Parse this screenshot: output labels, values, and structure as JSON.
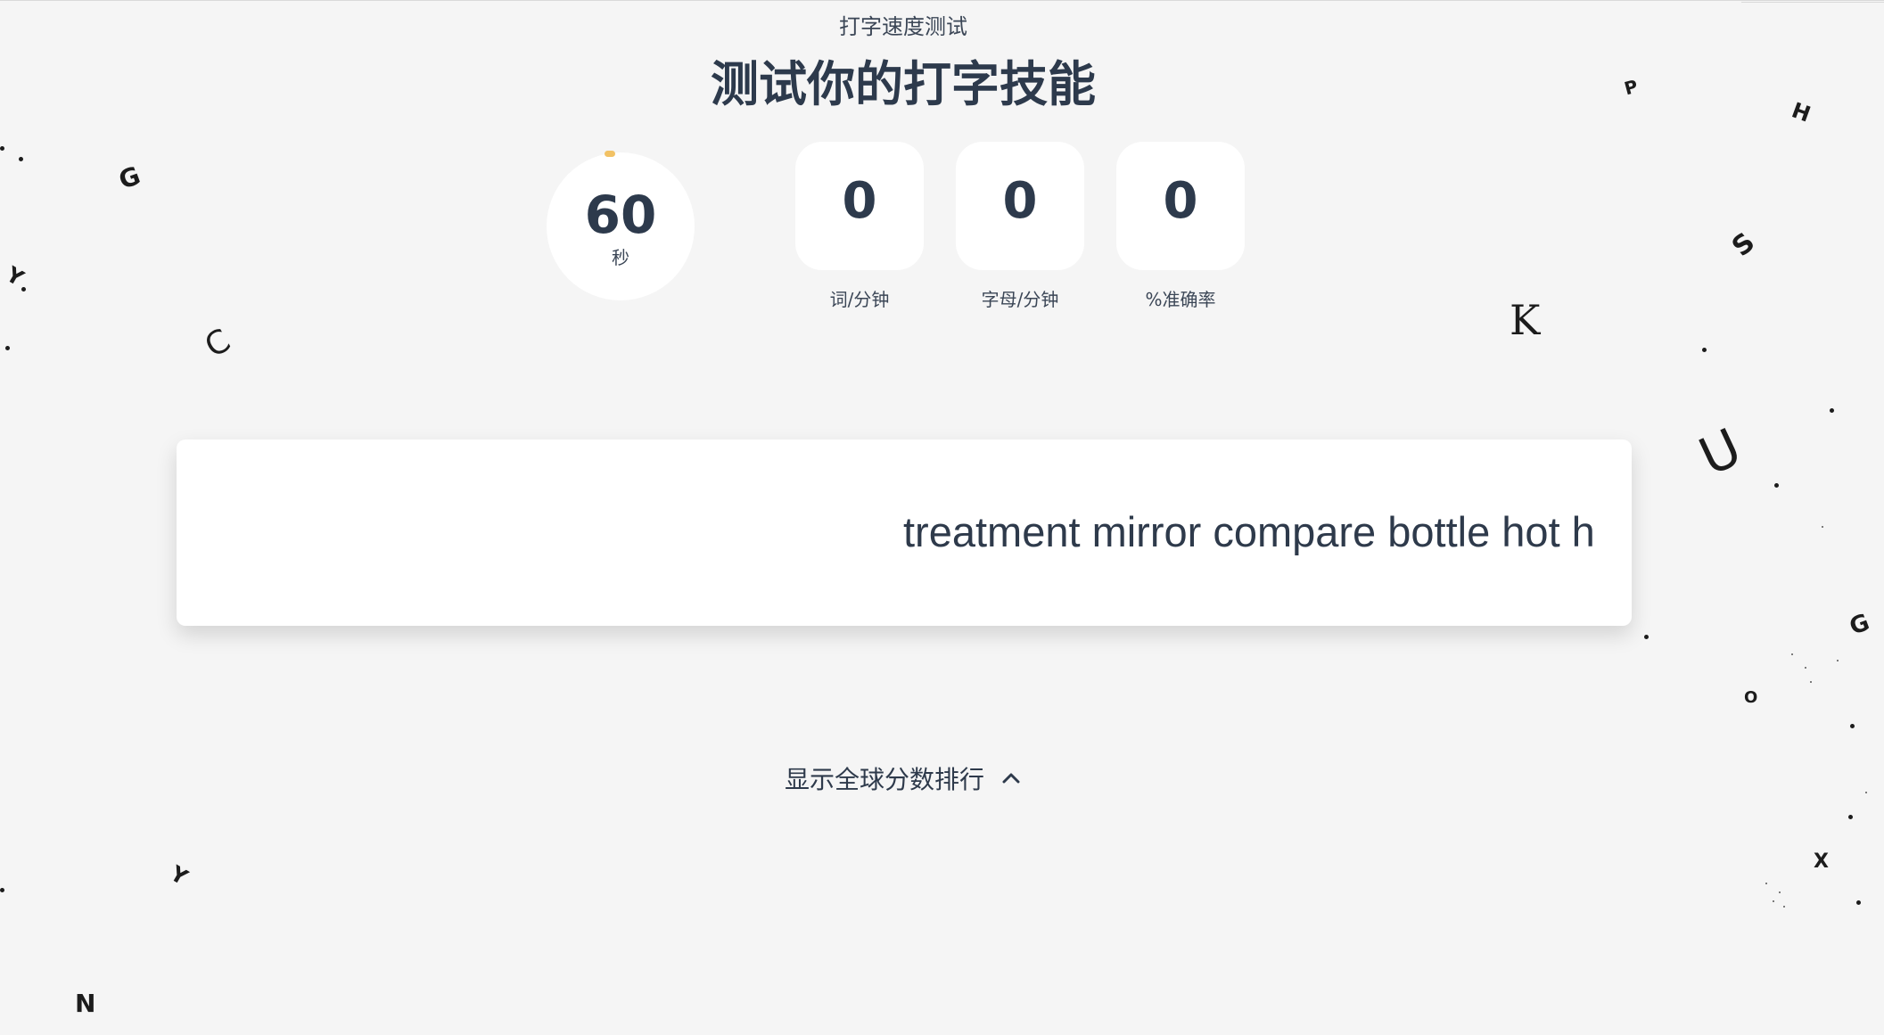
{
  "header": {
    "subtitle": "打字速度测试",
    "title": "测试你的打字技能"
  },
  "timer": {
    "value": "60",
    "unit": "秒",
    "progress_color": "#f2c265"
  },
  "stats": [
    {
      "value": "0",
      "label": "词/分钟"
    },
    {
      "value": "0",
      "label": "字母/分钟"
    },
    {
      "value": "0",
      "label": "%准确率"
    }
  ],
  "typing": {
    "text": "treatment mirror compare bottle hot h"
  },
  "leaderboard": {
    "toggle_label": "显示全球分数排行",
    "icon": "chevron-up-icon"
  },
  "background_letters": [
    "G",
    "Y",
    "C",
    "Y",
    "N",
    "P",
    "H",
    "S",
    "K",
    "U",
    "G",
    "O",
    "X"
  ],
  "colors": {
    "background": "#f5f5f5",
    "text": "#2e3a4b",
    "card": "#ffffff"
  }
}
